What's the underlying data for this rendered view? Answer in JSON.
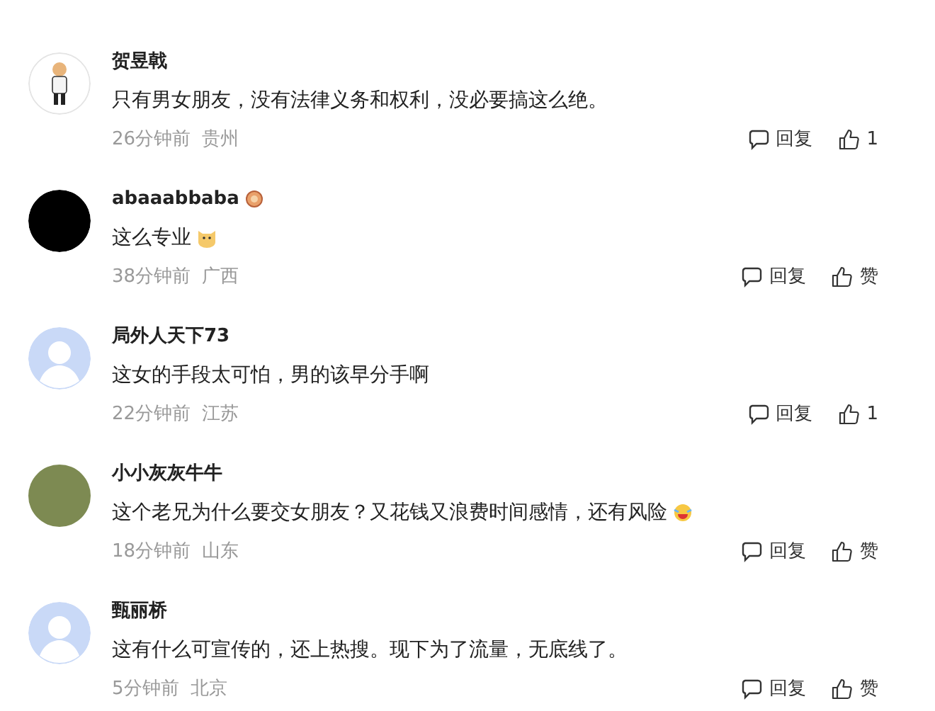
{
  "comments": [
    {
      "avatar": {
        "kind": "cartoon"
      },
      "name": "贺昱戟",
      "name_badge": false,
      "text": "只有男女朋友，没有法律义务和权利，没必要搞这么绝。",
      "time": "26分钟前",
      "location": "贵州",
      "reply": "回复",
      "like": "1"
    },
    {
      "avatar": {
        "kind": "black"
      },
      "name": "abaaabbaba",
      "name_badge": true,
      "text": "这么专业",
      "emoji": {
        "kind": "cat"
      },
      "time": "38分钟前",
      "location": "广西",
      "reply": "回复",
      "like": "赞"
    },
    {
      "avatar": {
        "kind": "default"
      },
      "name": "局外人天下73",
      "name_badge": false,
      "text": "这女的手段太可怕，男的该早分手啊",
      "time": "22分钟前",
      "location": "江苏",
      "reply": "回复",
      "like": "1"
    },
    {
      "avatar": {
        "kind": "photo"
      },
      "name": "小小灰灰牛牛",
      "name_badge": false,
      "text": "这个老兄为什么要交女朋友？又花钱又浪费时间感情，还有风险",
      "emoji": {
        "kind": "laugh-cry"
      },
      "time": "18分钟前",
      "location": "山东",
      "reply": "回复",
      "like": "赞"
    },
    {
      "avatar": {
        "kind": "default"
      },
      "name": "甄丽桥",
      "name_badge": false,
      "text": "这有什么可宣传的，还上热搜。现下为了流量，无底线了。",
      "time": "5分钟前",
      "location": "北京",
      "reply": "回复",
      "like": "赞"
    }
  ]
}
